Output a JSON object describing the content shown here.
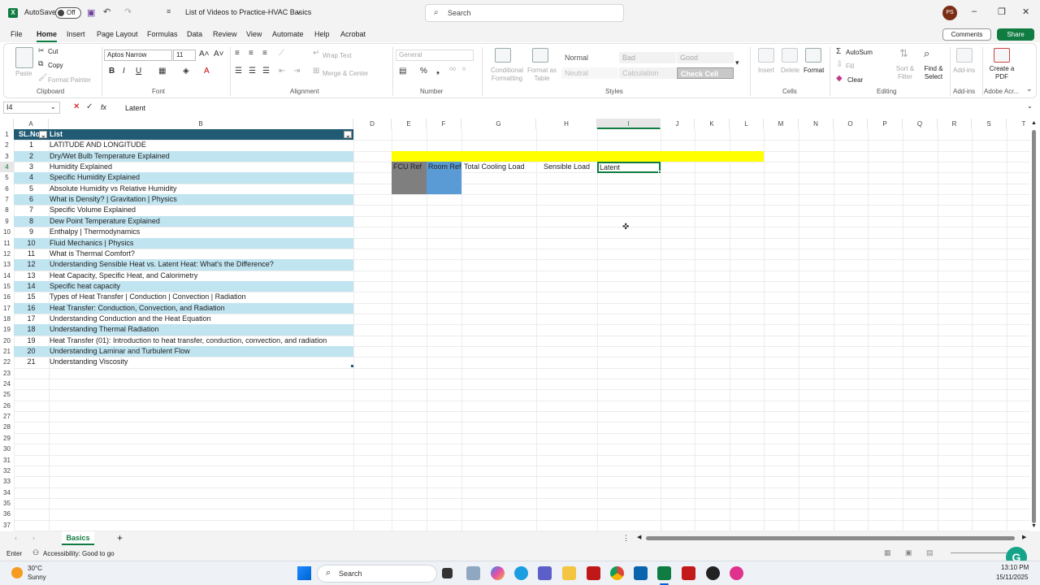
{
  "titlebar": {
    "autosave_label": "AutoSave",
    "autosave_state": "Off",
    "doc_title": "List of Videos to Practice-HVAC Basics",
    "search_placeholder": "Search",
    "avatar_initials": "PS"
  },
  "menu": {
    "tabs": [
      "File",
      "Home",
      "Insert",
      "Page Layout",
      "Formulas",
      "Data",
      "Review",
      "View",
      "Automate",
      "Help",
      "Acrobat"
    ],
    "active": "Home",
    "comments_label": "Comments",
    "share_label": "Share"
  },
  "ribbon": {
    "clipboard": {
      "paste": "Paste",
      "cut": "Cut",
      "copy": "Copy",
      "format_painter": "Format Painter",
      "label": "Clipboard"
    },
    "font": {
      "name": "Aptos Narrow",
      "size": "11",
      "label": "Font"
    },
    "alignment": {
      "wrap_text": "Wrap Text",
      "merge_center": "Merge & Center",
      "label": "Alignment"
    },
    "number": {
      "format": "General",
      "label": "Number"
    },
    "styles": {
      "conditional_formatting": "Conditional Formatting",
      "format_as_table": "Format as Table",
      "cells": [
        "Normal",
        "Bad",
        "Good",
        "Neutral",
        "Calculation",
        "Check Cell"
      ],
      "label": "Styles"
    },
    "cells_group": {
      "insert": "Insert",
      "delete": "Delete",
      "format": "Format",
      "label": "Cells"
    },
    "editing": {
      "autosum": "AutoSum",
      "fill": "Fill",
      "clear": "Clear",
      "sort_filter": "Sort & Filter",
      "find_select": "Find & Select",
      "label": "Editing"
    },
    "addins": {
      "addins": "Add-ins",
      "label": "Add-ins"
    },
    "adobe": {
      "create_pdf": "Create a PDF",
      "label": "Adobe Acr..."
    }
  },
  "formula_bar": {
    "name_box": "I4",
    "fx": "fx",
    "content": "Latent"
  },
  "columns": [
    "A",
    "B",
    "D",
    "E",
    "F",
    "G",
    "H",
    "I",
    "J",
    "K",
    "L",
    "M",
    "N",
    "O",
    "P",
    "Q",
    "R",
    "S",
    "T"
  ],
  "rows": [
    "1",
    "2",
    "3",
    "4",
    "5",
    "6",
    "7",
    "8",
    "9",
    "10",
    "11",
    "12",
    "13",
    "14",
    "15",
    "16",
    "17",
    "18",
    "19",
    "20",
    "21",
    "22",
    "23",
    "24",
    "25",
    "26",
    "27",
    "28",
    "29",
    "30",
    "31",
    "32",
    "33",
    "34",
    "35",
    "36",
    "37"
  ],
  "table": {
    "header_sl": "SL.No",
    "header_list": "List",
    "items": [
      {
        "n": "1",
        "t": "LATITUDE AND LONGITUDE"
      },
      {
        "n": "2",
        "t": "Dry/Wet Bulb Temperature Explained"
      },
      {
        "n": "3",
        "t": "Humidity Explained"
      },
      {
        "n": "4",
        "t": "Specific Humidity Explained"
      },
      {
        "n": "5",
        "t": "Absolute Humidity vs Relative Humidity"
      },
      {
        "n": "6",
        "t": "What is Density? | Gravitation | Physics"
      },
      {
        "n": "7",
        "t": "Specific Volume Explained"
      },
      {
        "n": "8",
        "t": "Dew Point Temperature Explained"
      },
      {
        "n": "9",
        "t": "Enthalpy | Thermodynamics"
      },
      {
        "n": "10",
        "t": "Fluid Mechanics | Physics"
      },
      {
        "n": "11",
        "t": "What is Thermal Comfort?"
      },
      {
        "n": "12",
        "t": "Understanding Sensible Heat vs. Latent Heat: What's the Difference?"
      },
      {
        "n": "13",
        "t": "Heat Capacity, Specific Heat, and Calorimetry"
      },
      {
        "n": "14",
        "t": "Specific heat capacity"
      },
      {
        "n": "15",
        "t": "Types of Heat Transfer | Conduction | Convection | Radiation"
      },
      {
        "n": "16",
        "t": "Heat Transfer: Conduction, Convection, and Radiation"
      },
      {
        "n": "17",
        "t": "Understanding Conduction and the Heat Equation"
      },
      {
        "n": "18",
        "t": "Understanding Thermal Radiation"
      },
      {
        "n": "19",
        "t": "Heat Transfer (01): Introduction to heat transfer, conduction, convection, and radiation"
      },
      {
        "n": "20",
        "t": "Understanding Laminar and Turbulent Flow"
      },
      {
        "n": "21",
        "t": "Understanding Viscosity"
      }
    ]
  },
  "load_table": {
    "fcu_ref": "FCU Ref",
    "room_ref": "Room Ref",
    "total_cooling": "Total Cooling Load",
    "sensible": "Sensible Load",
    "latent": "Latent",
    "colors": {
      "yellow": "#ffff00",
      "fcu": "#7f7f7f",
      "room": "#5b9bd5"
    }
  },
  "sheet": {
    "tab_name": "Basics",
    "add_icon": "+"
  },
  "status": {
    "mode": "Enter",
    "accessibility": "Accessibility: Good to go"
  },
  "taskbar": {
    "weather_temp": "30°C",
    "weather_desc": "Sunny",
    "search_placeholder": "Search",
    "time": "13:10 PM",
    "date": "15/11/2025"
  }
}
